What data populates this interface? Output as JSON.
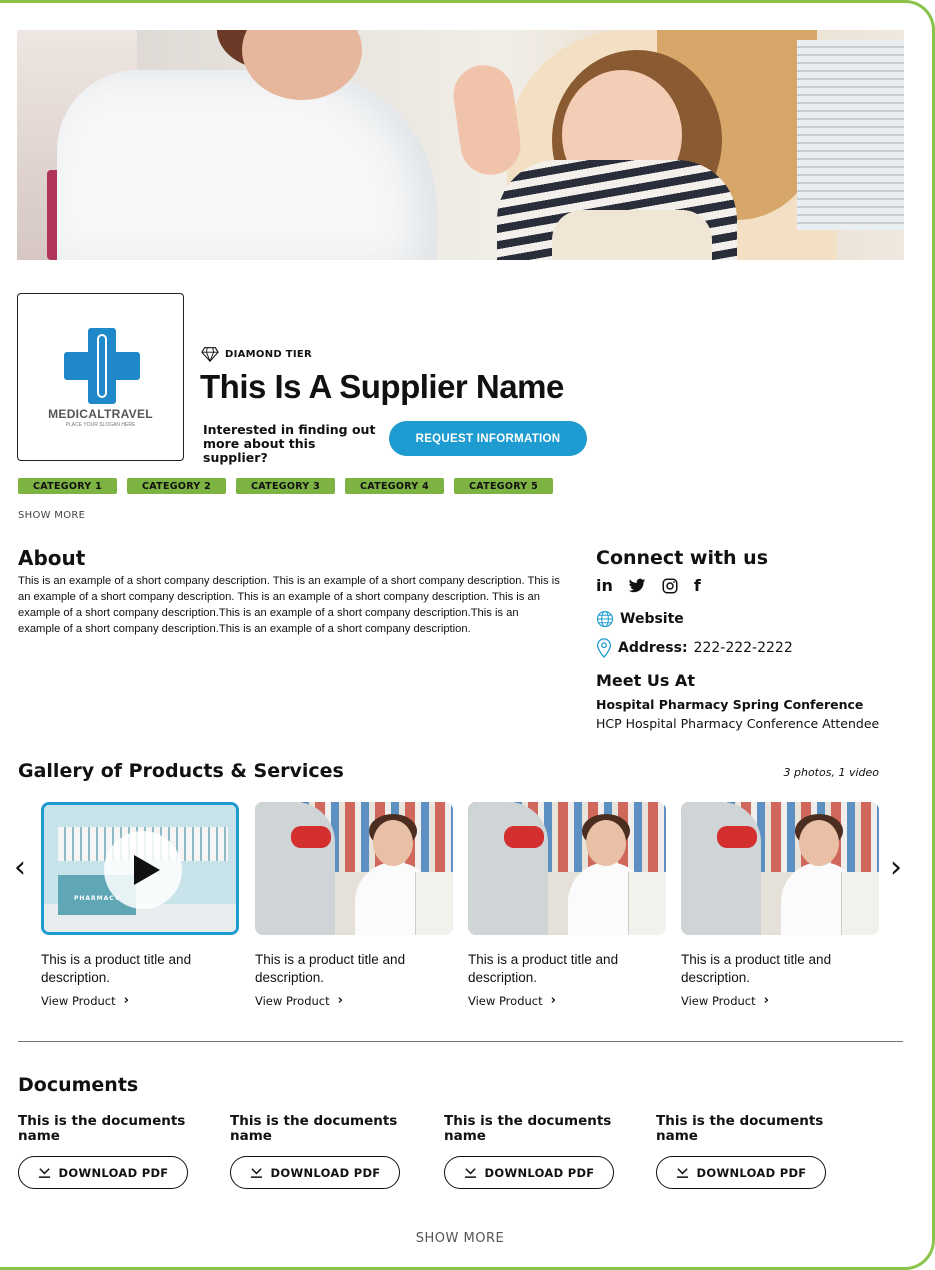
{
  "supplier": {
    "tier": "DIAMOND TIER",
    "name": "This Is A Supplier Name",
    "logo_name": "MEDICALTRAVEL",
    "logo_slogan": "PLACE YOUR SLOGAN HERE",
    "interest_text": "Interested in finding out more about this supplier?",
    "request_button": "REQUEST INFORMATION"
  },
  "categories": [
    "CATEGORY 1",
    "CATEGORY 2",
    "CATEGORY 3",
    "CATEGORY 4",
    "CATEGORY 5"
  ],
  "categories_show_more": "SHOW MORE",
  "about": {
    "title": "About",
    "text": "This is an example of a short company description. This is an example of a short company description. This is an example of a short company description. This is an example of a short company description. This is an example of a short company description.This is an example of a short company description.This is an example of a short company description.This is an example of a short company description."
  },
  "connect": {
    "title": "Connect with us",
    "socials": [
      "linkedin-icon",
      "twitter-icon",
      "instagram-icon",
      "facebook-icon"
    ],
    "linkedin_label": "in",
    "facebook_label": "f",
    "website_label": "Website",
    "address_label": "Address:",
    "address_value": "222-222-2222"
  },
  "meet": {
    "title": "Meet Us At",
    "conference": "Hospital Pharmacy Spring Conference",
    "role": "HCP Hospital Pharmacy Conference Attendee"
  },
  "gallery": {
    "title": "Gallery of Products & Services",
    "count": "3 photos, 1 video",
    "items": [
      {
        "title": "This is a product title and description.",
        "link": "View Product",
        "type": "video",
        "thumb_label": "PHARMACY"
      },
      {
        "title": "This is a product title and description.",
        "link": "View Product",
        "type": "photo"
      },
      {
        "title": "This is a product title and description.",
        "link": "View Product",
        "type": "photo"
      },
      {
        "title": "This is a product title and description.",
        "link": "View Product",
        "type": "photo"
      }
    ]
  },
  "documents": {
    "title": "Documents",
    "items": [
      {
        "name": "This is the documents name",
        "button": "DOWNLOAD PDF"
      },
      {
        "name": "This is the documents name",
        "button": "DOWNLOAD PDF"
      },
      {
        "name": "This is the documents name",
        "button": "DOWNLOAD PDF"
      },
      {
        "name": "This is the documents name",
        "button": "DOWNLOAD PDF"
      }
    ]
  },
  "show_more": "SHOW MORE",
  "colors": {
    "accent_green": "#8bc34a",
    "category_green": "#7cb342",
    "button_blue": "#1e9bd0",
    "logo_blue": "#1e88c9"
  }
}
